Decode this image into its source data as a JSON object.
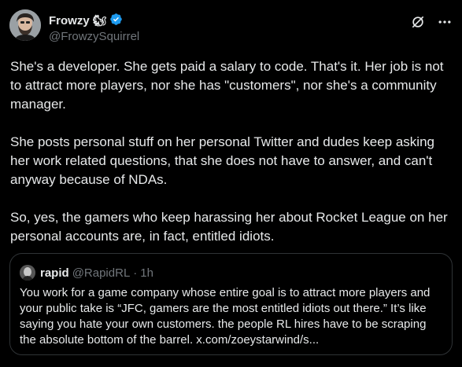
{
  "author": {
    "name": "Frowzy",
    "emoji": "🐿",
    "handle": "@FrowzySquirrel",
    "verified_color": "#1d9bf0"
  },
  "tweet": {
    "text": "She's a developer. She gets paid a salary to code. That's it. Her job is not to attract more players, nor she has \"customers\", nor she's a community manager.\n\nShe posts personal stuff on her personal Twitter and dudes keep asking her work related questions, that she does not have to answer, and can't anyway because of NDAs.\n\nSo, yes, the gamers who keep harassing her about Rocket League on her personal accounts are, in fact, entitled idiots."
  },
  "quote": {
    "name": "rapid",
    "handle": "@RapidRL",
    "separator": "·",
    "time": "1h",
    "text": "You work for a game company whose entire goal is to attract more players and your public take is “JFC, gamers are the most entitled idiots out there.” It’s like saying you hate your own customers. the people RL hires have to be scraping the absolute bottom of the barrel. x.com/zoeystarwind/s..."
  },
  "icons": {
    "grok": "grok-icon",
    "more": "more-icon",
    "verified": "verified-badge-icon"
  },
  "colors": {
    "background": "#000000",
    "text": "#e7e9ea",
    "muted": "#71767b",
    "border": "#2f3336"
  }
}
